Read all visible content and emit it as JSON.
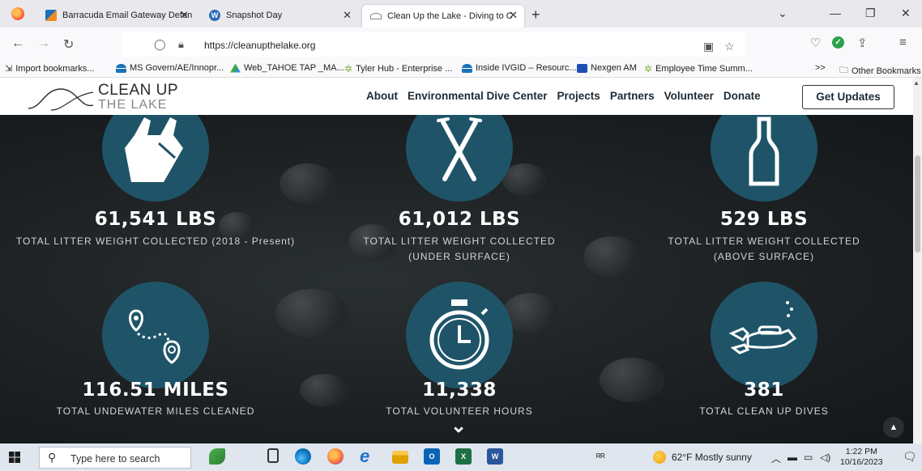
{
  "browser": {
    "tabs": [
      {
        "title": "Barracuda Email Gateway Defen",
        "active": false
      },
      {
        "title": "Snapshot Day",
        "active": false
      },
      {
        "title": "Clean Up the Lake - Diving to C",
        "active": true
      }
    ],
    "url": "https://cleanupthelake.org",
    "bookmarks": [
      "Import bookmarks...",
      "MS Govern/AE/Innopr...",
      "Web_TAHOE TAP _MA...",
      "Tyler Hub - Enterprise ...",
      "Inside IVGID – Resourc...",
      "Nexgen AM",
      "Employee Time Summ..."
    ],
    "other_bookmarks": "Other Bookmarks",
    "overflow": ">>"
  },
  "site": {
    "logo_line1": "CLEAN UP",
    "logo_line2": "THE LAKE",
    "nav": [
      "About",
      "Environmental Dive Center",
      "Projects",
      "Partners",
      "Volunteer",
      "Donate"
    ],
    "cta": "Get Updates"
  },
  "stats": [
    {
      "value": "61,541 LBS",
      "label": "TOTAL LITTER WEIGHT COLLECTED (2018 - Present)",
      "label2": "",
      "icon": "plastic-bag-icon"
    },
    {
      "value": "61,012 LBS",
      "label": "TOTAL LITTER WEIGHT COLLECTED",
      "label2": "(UNDER SURFACE)",
      "icon": "straws-icon"
    },
    {
      "value": "529 LBS",
      "label": "TOTAL LITTER WEIGHT COLLECTED",
      "label2": "(ABOVE SURFACE)",
      "icon": "bottle-icon"
    },
    {
      "value": "116.51 MILES",
      "label": "TOTAL UNDEWATER MILES CLEANED",
      "label2": "",
      "icon": "route-pins-icon"
    },
    {
      "value": "11,338",
      "label": "TOTAL VOLUNTEER HOURS",
      "label2": "",
      "icon": "stopwatch-icon"
    },
    {
      "value": "381",
      "label": "TOTAL CLEAN UP DIVES",
      "label2": "",
      "icon": "diver-icon"
    }
  ],
  "taskbar": {
    "search_placeholder": "Type here to search",
    "weather": "62°F  Mostly sunny",
    "time": "1:22 PM",
    "date": "10/16/2023"
  },
  "colors": {
    "circle": "#1f5468",
    "hero_bg": "#1d2123"
  }
}
